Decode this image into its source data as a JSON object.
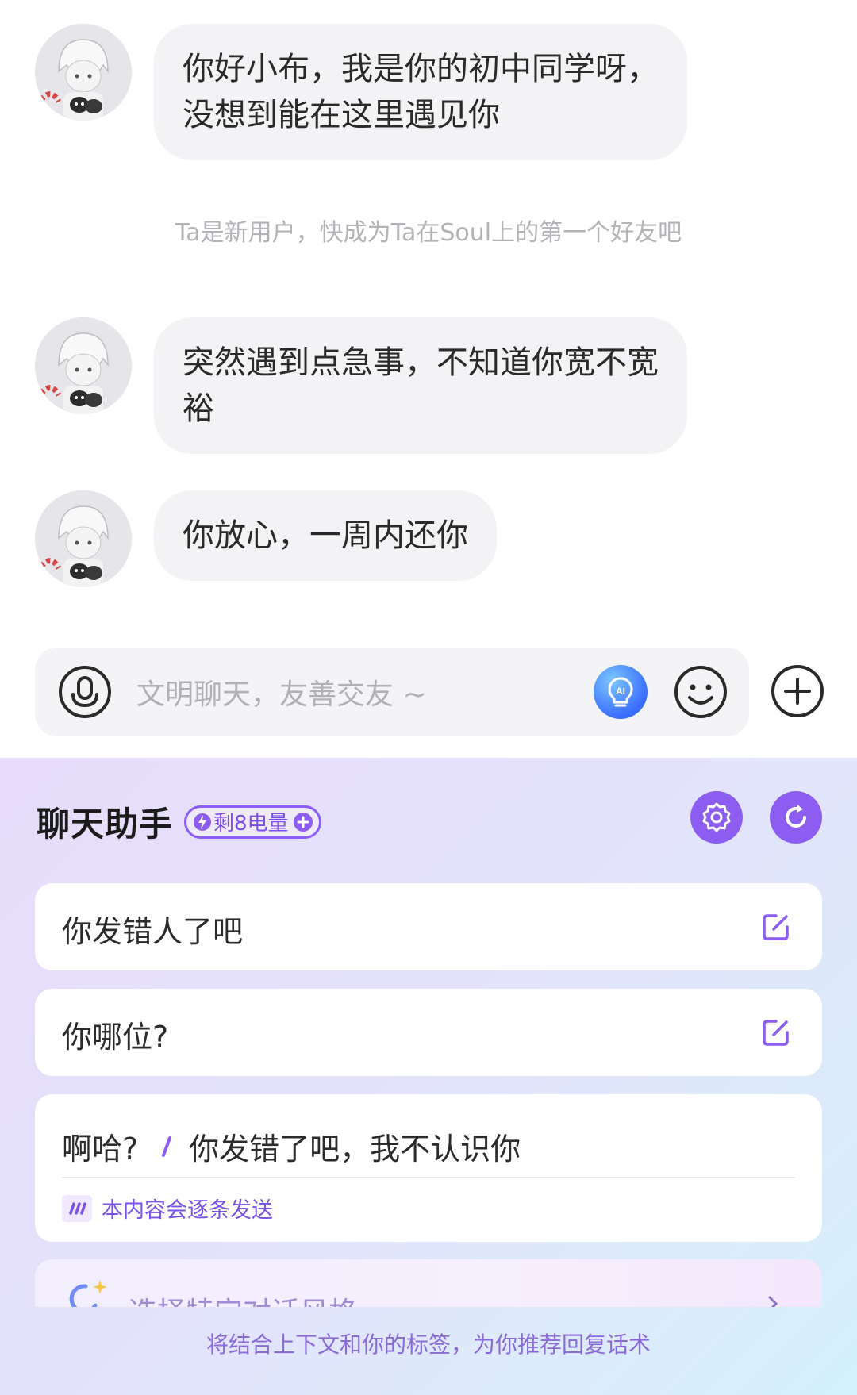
{
  "messages": [
    {
      "text_line1": "你好小布，我是你的初中同学呀，",
      "text_line2": "没想到能在这里遇见你"
    },
    {
      "text_line1": "突然遇到点急事，不知道你宽不宽",
      "text_line2": "裕"
    },
    {
      "text": "你放心，一周内还你"
    }
  ],
  "system_note": "Ta是新用户，快成为Ta在Soul上的第一个好友吧",
  "input": {
    "placeholder": "文明聊天，友善交友 ~"
  },
  "assistant": {
    "title": "聊天助手",
    "energy_label": "剩8电量",
    "suggestions": [
      {
        "text": "你发错人了吧"
      },
      {
        "text": "你哪位?"
      },
      {
        "part1": "啊哈?",
        "part2": "你发错了吧，我不认识你"
      }
    ],
    "sequential_note": "本内容会逐条发送",
    "style_option": "选择特定对话风格",
    "footer_note": "将结合上下文和你的标签，为你推荐回复话术"
  },
  "colors": {
    "accent": "#8d5cf0",
    "bubble": "#f3f3f5",
    "muted": "#b3b3b8"
  },
  "icons": [
    "avatar-illustration",
    "voice-icon",
    "ai-bulb-icon",
    "emoji-icon",
    "plus-icon",
    "bolt-icon",
    "gear-icon",
    "refresh-icon",
    "edit-icon",
    "sequence-icon",
    "sparkle-icon"
  ]
}
